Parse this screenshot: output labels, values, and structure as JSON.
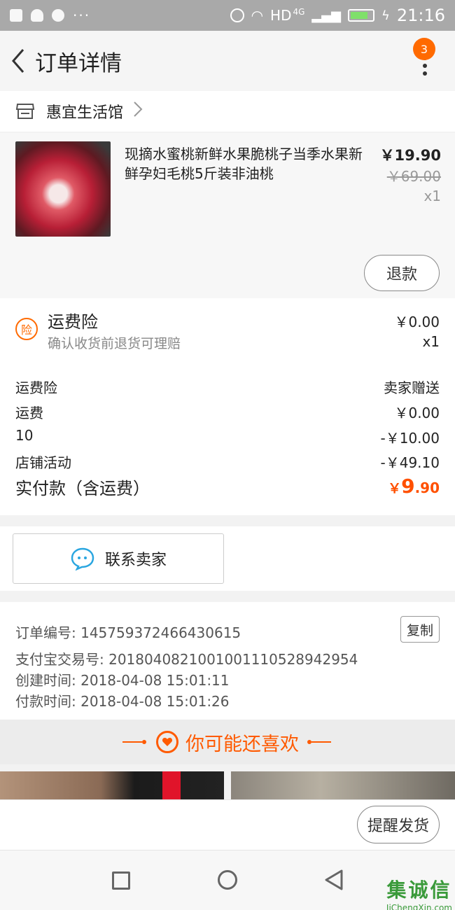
{
  "status_bar": {
    "time": "21:16",
    "network": "HD",
    "network_sub": "4G",
    "dots": "···"
  },
  "header": {
    "title": "订单详情",
    "badge_count": "3"
  },
  "shop": {
    "name": "惠宜生活馆"
  },
  "product": {
    "title": "现摘水蜜桃新鲜水果脆桃子当季水果新鲜孕妇毛桃5斤装非油桃",
    "price": "￥19.90",
    "original_price": "￥69.00",
    "quantity": "x1",
    "refund_label": "退款"
  },
  "insurance": {
    "icon_text": "险",
    "title": "运费险",
    "subtitle": "确认收货前退货可理赔",
    "amount": "￥0.00",
    "quantity": "x1"
  },
  "summary": {
    "rows": [
      {
        "label": "运费险",
        "value": "卖家赠送"
      },
      {
        "label": "运费",
        "value": "￥0.00"
      },
      {
        "label": "10",
        "value": "-￥10.00"
      },
      {
        "label": "店铺活动",
        "value": "-￥49.10"
      }
    ],
    "total_label": "实付款（含运费）",
    "total_yen": "￥",
    "total_int": "9",
    "total_dec": ".90"
  },
  "contact": {
    "label": "联系卖家"
  },
  "order_info": {
    "order_no": "订单编号: 145759372466430615",
    "alipay_no": "支付宝交易号: 2018040821001001110528942954",
    "created": "创建时间: 2018-04-08 15:01:11",
    "paid": "付款时间: 2018-04-08 15:01:26",
    "copy_label": "复制"
  },
  "recommend": {
    "title": "你可能还喜欢"
  },
  "bottom": {
    "remind_label": "提醒发货"
  },
  "watermark": {
    "text": "集诚信",
    "url": "JiChengXin.com"
  },
  "colors": {
    "accent": "#ff5000",
    "badge": "#ff6a00",
    "status_bar": "#a9a9a9"
  }
}
